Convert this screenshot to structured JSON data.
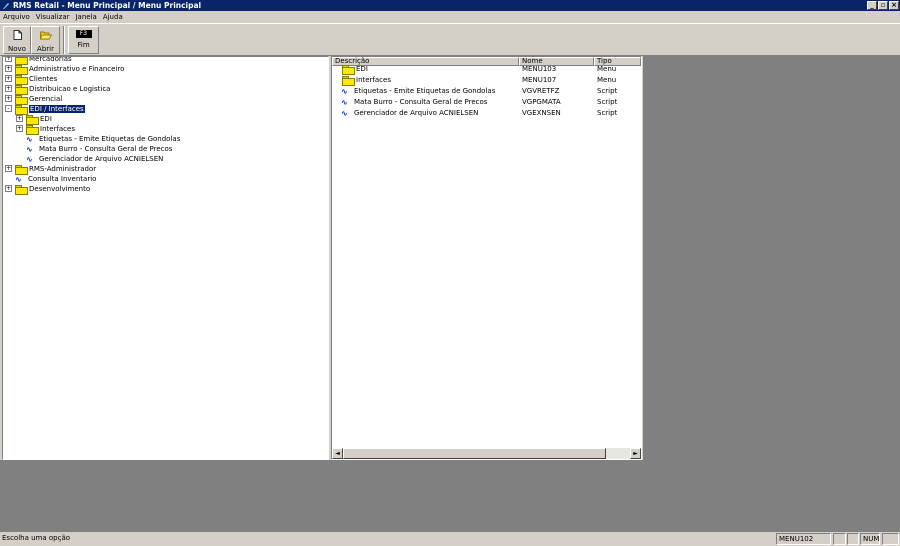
{
  "window": {
    "title": "RMS Retail - Menu Principal / Menu Principal"
  },
  "menubar": {
    "items": [
      {
        "label": "Arquivo"
      },
      {
        "label": "Visualizar"
      },
      {
        "label": "Janela"
      },
      {
        "label": "Ajuda"
      }
    ]
  },
  "toolbar": {
    "novo_label": "Novo",
    "abrir_label": "Abrir",
    "fim_label": "Fim",
    "fim_key": "F3"
  },
  "tree": {
    "items": [
      {
        "label": "Mercadorias",
        "type": "folder",
        "level": 0,
        "expander": "+"
      },
      {
        "label": "Administrativo e Financeiro",
        "type": "folder",
        "level": 0,
        "expander": "+"
      },
      {
        "label": "Clientes",
        "type": "folder",
        "level": 0,
        "expander": "+"
      },
      {
        "label": "Distribuicao e Logistica",
        "type": "folder",
        "level": 0,
        "expander": "+"
      },
      {
        "label": "Gerencial",
        "type": "folder",
        "level": 0,
        "expander": "+"
      },
      {
        "label": "EDI / Interfaces",
        "type": "folder-open",
        "level": 0,
        "expander": "-",
        "selected": true
      },
      {
        "label": "EDI",
        "type": "folder",
        "level": 1,
        "expander": "+"
      },
      {
        "label": "Interfaces",
        "type": "folder",
        "level": 1,
        "expander": "+"
      },
      {
        "label": "Etiquetas - Emite Etiquetas de Gondolas",
        "type": "script",
        "level": 1
      },
      {
        "label": "Mata Burro - Consulta Geral de Precos",
        "type": "script",
        "level": 1
      },
      {
        "label": "Gerenciador de Arquivo ACNIELSEN",
        "type": "script",
        "level": 1
      },
      {
        "label": "RMS-Administrador",
        "type": "folder",
        "level": 0,
        "expander": "+"
      },
      {
        "label": "Consulta Inventario",
        "type": "script",
        "level": 0
      },
      {
        "label": "Desenvolvimento",
        "type": "folder",
        "level": 0,
        "expander": "+"
      }
    ]
  },
  "list": {
    "headers": {
      "descricao": "Descrição",
      "nome": "Nome",
      "tipo": "Tipo"
    },
    "rows": [
      {
        "descricao": "EDI",
        "nome": "MENU103",
        "tipo": "Menu",
        "icon": "folder"
      },
      {
        "descricao": "Interfaces",
        "nome": "MENU107",
        "tipo": "Menu",
        "icon": "folder"
      },
      {
        "descricao": "Etiquetas - Emite Etiquetas de Gondolas",
        "nome": "VGVRETFZ",
        "tipo": "Script",
        "icon": "script"
      },
      {
        "descricao": "Mata Burro - Consulta Geral de Precos",
        "nome": "VGPGMATA",
        "tipo": "Script",
        "icon": "script"
      },
      {
        "descricao": "Gerenciador de Arquivo ACNIELSEN",
        "nome": "VGEXNSEN",
        "tipo": "Script",
        "icon": "script"
      }
    ]
  },
  "statusbar": {
    "message": "Escolha uma opção",
    "menu_code": "MENU102",
    "num_indicator": "NUM"
  },
  "colors": {
    "titlebar": "#0a246a",
    "workspace": "#808080",
    "chrome": "#d4d0c8"
  }
}
